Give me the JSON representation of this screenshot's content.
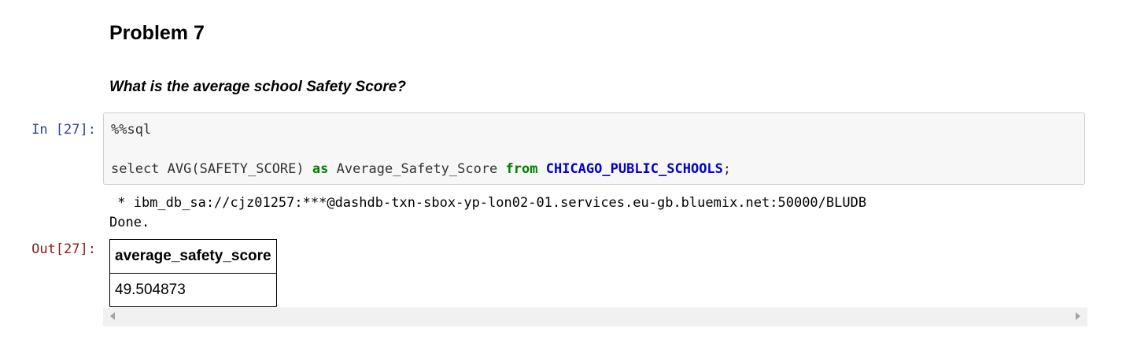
{
  "markdown": {
    "heading": "Problem 7",
    "question": "What is the average school Safety Score?"
  },
  "input_cell": {
    "prompt": "In [27]:",
    "magic": "%%sql",
    "code": {
      "select": "select AVG(SAFETY_SCORE) ",
      "as": "as",
      "alias": " Average_Safety_Score ",
      "from": "from",
      "space": " ",
      "table": "CHICAGO_PUBLIC_SCHOOLS",
      "end": ";"
    }
  },
  "output": {
    "stdout_line1": " * ibm_db_sa://cjz01257:***@dashdb-txn-sbox-yp-lon02-01.services.eu-gb.bluemix.net:50000/BLUDB",
    "stdout_line2": "Done.",
    "prompt": "Out[27]:",
    "table": {
      "header": "average_safety_score",
      "value": "49.504873"
    }
  },
  "icons": {
    "scroll_left": "chevron-left-icon",
    "scroll_right": "chevron-right-icon"
  },
  "colors": {
    "in_prompt": "#303f9f",
    "out_prompt": "#8b1a1a",
    "keyword": "#008000",
    "table_name": "#0000cc"
  }
}
